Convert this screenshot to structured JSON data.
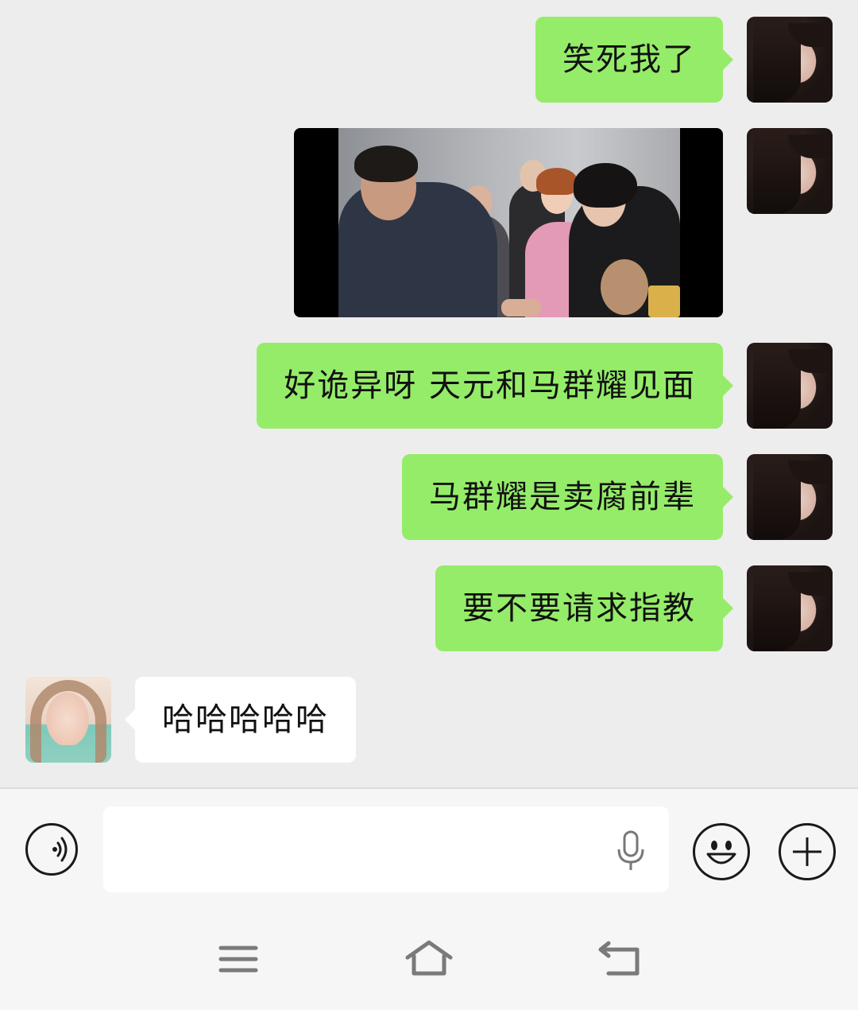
{
  "messages": [
    {
      "side": "out",
      "type": "text",
      "text": "笑死我了"
    },
    {
      "side": "out",
      "type": "image"
    },
    {
      "side": "out",
      "type": "text",
      "text": "好诡异呀 天元和马群耀见面"
    },
    {
      "side": "out",
      "type": "text",
      "text": "马群耀是卖腐前辈"
    },
    {
      "side": "out",
      "type": "text",
      "text": "要不要请求指教"
    },
    {
      "side": "in",
      "type": "text",
      "text": "哈哈哈哈哈"
    }
  ],
  "input_bar": {
    "voice_toggle_icon": "voice-mode-icon",
    "text_value": "",
    "mic_icon": "microphone-icon",
    "emoji_icon": "emoji-icon",
    "more_icon": "plus-icon"
  },
  "nav_bar": {
    "menu_icon": "menu-icon",
    "home_icon": "home-icon",
    "back_icon": "back-icon"
  },
  "colors": {
    "background": "#ededed",
    "outgoing_bubble": "#95ec69",
    "incoming_bubble": "#ffffff"
  }
}
